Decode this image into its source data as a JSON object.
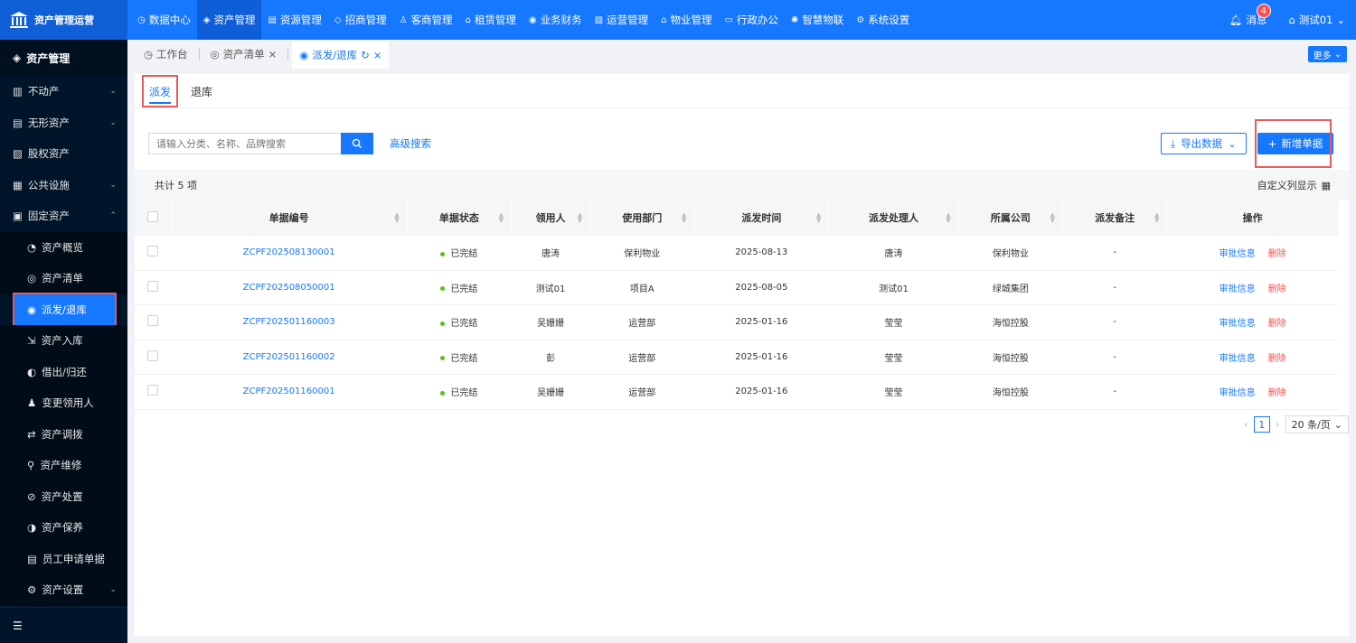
{
  "brand": {
    "title": "资产管理运营"
  },
  "topnav": [
    {
      "label": "数据中心",
      "icon": "dashboard-icon"
    },
    {
      "label": "资产管理",
      "icon": "asset-icon",
      "active": true
    },
    {
      "label": "资源管理",
      "icon": "resource-icon"
    },
    {
      "label": "招商管理",
      "icon": "tag-icon"
    },
    {
      "label": "客商管理",
      "icon": "customer-icon"
    },
    {
      "label": "租赁管理",
      "icon": "lease-icon"
    },
    {
      "label": "业务财务",
      "icon": "finance-icon"
    },
    {
      "label": "运营管理",
      "icon": "operation-icon"
    },
    {
      "label": "物业管理",
      "icon": "property-icon"
    },
    {
      "label": "行政办公",
      "icon": "office-icon"
    },
    {
      "label": "智慧物联",
      "icon": "iot-icon"
    },
    {
      "label": "系统设置",
      "icon": "settings-icon"
    }
  ],
  "header_right": {
    "messages_label": "消息",
    "messages_count": "4",
    "user_label": "测试01"
  },
  "sidebar": {
    "title": "资产管理",
    "items": [
      {
        "label": "不动产",
        "icon": "building-icon",
        "caret": "⌄"
      },
      {
        "label": "无形资产",
        "icon": "doc-icon",
        "caret": "⌄"
      },
      {
        "label": "股权资产",
        "icon": "equity-icon",
        "caret": ""
      },
      {
        "label": "公共设施",
        "icon": "facility-icon",
        "caret": "⌄"
      },
      {
        "label": "固定资产",
        "icon": "fixed-asset-icon",
        "caret": "⌃"
      }
    ],
    "sub_items": [
      {
        "label": "资产概览",
        "icon": "overview-icon"
      },
      {
        "label": "资产清单",
        "icon": "list-icon"
      },
      {
        "label": "派发/退库",
        "icon": "dispatch-icon",
        "active": true
      },
      {
        "label": "资产入库",
        "icon": "inbound-icon"
      },
      {
        "label": "借出/归还",
        "icon": "lend-icon"
      },
      {
        "label": "变更领用人",
        "icon": "user-change-icon"
      },
      {
        "label": "资产调拨",
        "icon": "transfer-icon"
      },
      {
        "label": "资产维修",
        "icon": "repair-icon"
      },
      {
        "label": "资产处置",
        "icon": "dispose-icon"
      },
      {
        "label": "资产保养",
        "icon": "maintain-icon"
      },
      {
        "label": "员工申请单据",
        "icon": "apply-icon"
      },
      {
        "label": "资产设置",
        "icon": "asset-settings-icon",
        "caret": "⌄"
      }
    ]
  },
  "tabs": [
    {
      "label": "工作台",
      "closable": false
    },
    {
      "label": "资产清单",
      "closable": true
    },
    {
      "label": "派发/退库",
      "closable": true,
      "active": true
    }
  ],
  "more_label": "更多",
  "subtabs": [
    {
      "label": "派发",
      "active": true
    },
    {
      "label": "退库"
    }
  ],
  "toolbar": {
    "search_placeholder": "请输入分类、名称、品牌搜索",
    "advanced_label": "高级搜索",
    "export_label": "导出数据",
    "add_label": "新增单据"
  },
  "summary": {
    "total_label": "共计 5 项",
    "customize_label": "自定义列显示"
  },
  "table": {
    "columns": [
      "单据编号",
      "单据状态",
      "领用人",
      "使用部门",
      "派发时间",
      "派发处理人",
      "所属公司",
      "派发备注",
      "操作"
    ],
    "rows": [
      {
        "code": "ZCPF202508130001",
        "status": "已完结",
        "receiver": "唐涛",
        "dept": "保利物业",
        "date": "2025-08-13",
        "handler": "唐涛",
        "company": "保利物业",
        "remark": "-"
      },
      {
        "code": "ZCPF202508050001",
        "status": "已完结",
        "receiver": "测试01",
        "dept": "项目A",
        "date": "2025-08-05",
        "handler": "测试01",
        "company": "绿城集团",
        "remark": "-"
      },
      {
        "code": "ZCPF202501160003",
        "status": "已完结",
        "receiver": "吴姗姗",
        "dept": "运营部",
        "date": "2025-01-16",
        "handler": "莹莹",
        "company": "海恒控股",
        "remark": "-"
      },
      {
        "code": "ZCPF202501160002",
        "status": "已完结",
        "receiver": "彭",
        "dept": "运营部",
        "date": "2025-01-16",
        "handler": "莹莹",
        "company": "海恒控股",
        "remark": "-"
      },
      {
        "code": "ZCPF202501160001",
        "status": "已完结",
        "receiver": "吴姗姗",
        "dept": "运营部",
        "date": "2025-01-16",
        "handler": "莹莹",
        "company": "海恒控股",
        "remark": "-"
      }
    ],
    "op_approve": "审批信息",
    "op_delete": "删除"
  },
  "pager": {
    "current": "1",
    "page_size": "20 条/页"
  }
}
